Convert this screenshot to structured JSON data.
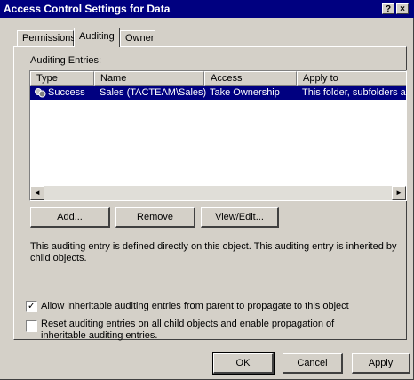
{
  "window": {
    "title": "Access Control Settings for Data",
    "help_glyph": "?",
    "close_glyph": "×"
  },
  "tabs": [
    {
      "label": "Permissions",
      "active": false
    },
    {
      "label": "Auditing",
      "active": true
    },
    {
      "label": "Owner",
      "active": false
    }
  ],
  "auditing": {
    "entries_label": "Auditing Entries:",
    "columns": [
      "Type",
      "Name",
      "Access",
      "Apply to"
    ],
    "rows": [
      {
        "type": "Success",
        "name": "Sales (TACTEAM\\Sales)",
        "access": "Take Ownership",
        "apply_to": "This folder, subfolders and files",
        "icon": "audit-entry-icon",
        "selected": true
      }
    ],
    "scroll_left_glyph": "◄",
    "scroll_right_glyph": "►"
  },
  "buttons": {
    "add": "Add...",
    "remove": "Remove",
    "view_edit": "View/Edit..."
  },
  "description": "This auditing entry is defined directly on this object. This auditing entry is inherited by child objects.",
  "options": {
    "allow_inheritable": {
      "label": "Allow inheritable auditing entries from parent to propagate to this object",
      "checked": true
    },
    "reset_child": {
      "label": "Reset auditing entries on all child objects and enable propagation of inheritable auditing entries.",
      "checked": false
    }
  },
  "footer": {
    "ok": "OK",
    "cancel": "Cancel",
    "apply": "Apply"
  },
  "colors": {
    "titlebar": "#000080",
    "face": "#d4d0c8",
    "selection": "#000080"
  }
}
